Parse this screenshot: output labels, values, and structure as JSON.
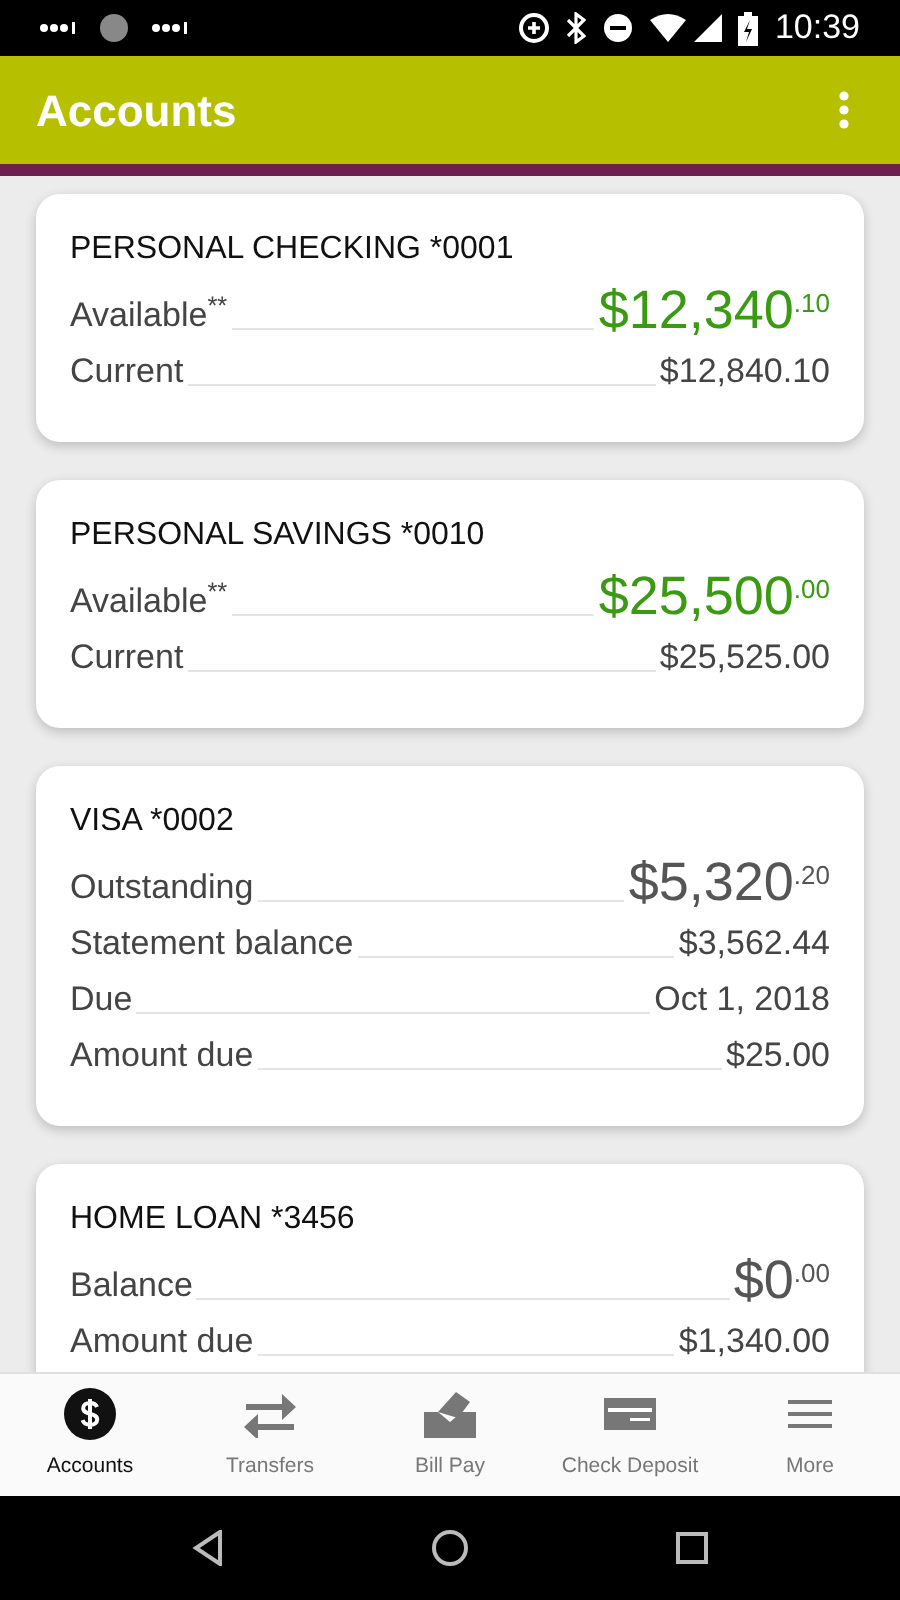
{
  "status_bar": {
    "time": "10:39"
  },
  "app_bar": {
    "title": "Accounts"
  },
  "accounts": [
    {
      "name": "PERSONAL CHECKING *0001",
      "rows": [
        {
          "kind": "big",
          "label": "Available$^{**}$",
          "amount": "$12,340",
          "cents": ".10",
          "positive": true
        },
        {
          "kind": "plain",
          "label": "Current",
          "value": "$12,840.10"
        }
      ]
    },
    {
      "name": "PERSONAL SAVINGS *0010",
      "rows": [
        {
          "kind": "big",
          "label": "Available$^{**}$",
          "amount": "$25,500",
          "cents": ".00",
          "positive": true
        },
        {
          "kind": "plain",
          "label": "Current",
          "value": "$25,525.00"
        }
      ]
    },
    {
      "name": "VISA *0002",
      "rows": [
        {
          "kind": "big",
          "label": "Outstanding",
          "amount": "$5,320",
          "cents": ".20",
          "positive": false
        },
        {
          "kind": "plain",
          "label": "Statement balance",
          "value": "$3,562.44"
        },
        {
          "kind": "plain",
          "label": "Due",
          "value": "Oct 1, 2018"
        },
        {
          "kind": "plain",
          "label": "Amount due",
          "value": "$25.00"
        }
      ]
    },
    {
      "name": "HOME LOAN *3456",
      "rows": [
        {
          "kind": "big",
          "label": "Balance",
          "amount": "$0",
          "cents": ".00",
          "positive": false
        },
        {
          "kind": "plain",
          "label": "Amount due",
          "value": "$1,340.00"
        }
      ]
    }
  ],
  "bottom_nav": [
    {
      "kind": "dollar",
      "label": "Accounts",
      "selected": true
    },
    {
      "kind": "transfer",
      "label": "Transfers",
      "selected": false
    },
    {
      "kind": "billpay",
      "label": "Bill Pay",
      "selected": false
    },
    {
      "kind": "check",
      "label": "Check Deposit",
      "selected": false
    },
    {
      "kind": "menu",
      "label": "More",
      "selected": false
    }
  ]
}
